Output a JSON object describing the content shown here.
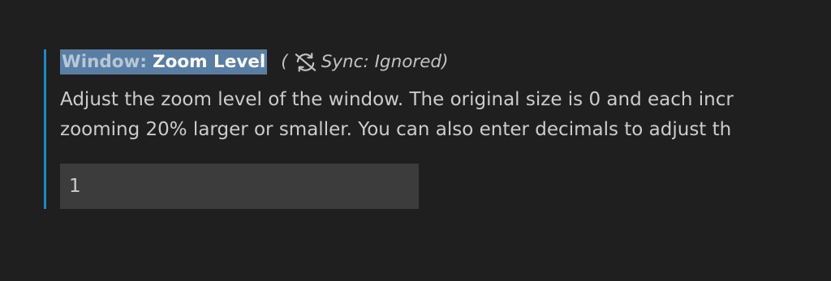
{
  "setting": {
    "category": "Window:",
    "label": "Zoom Level",
    "sync_text": "Sync: Ignored)",
    "sync_open_paren": "(",
    "sync_icon": "sync-ignored-icon",
    "description_lines": [
      "Adjust the zoom level of the window. The original size is 0 and each incr",
      "zooming 20% larger or smaller. You can also enter decimals to adjust th"
    ],
    "value": "1"
  },
  "colors": {
    "background": "#1f1f1f",
    "focus_bar": "#1b8bc4",
    "title_highlight": "#5a7ea3",
    "input_background": "#3c3c3c",
    "text": "#cccccc"
  }
}
